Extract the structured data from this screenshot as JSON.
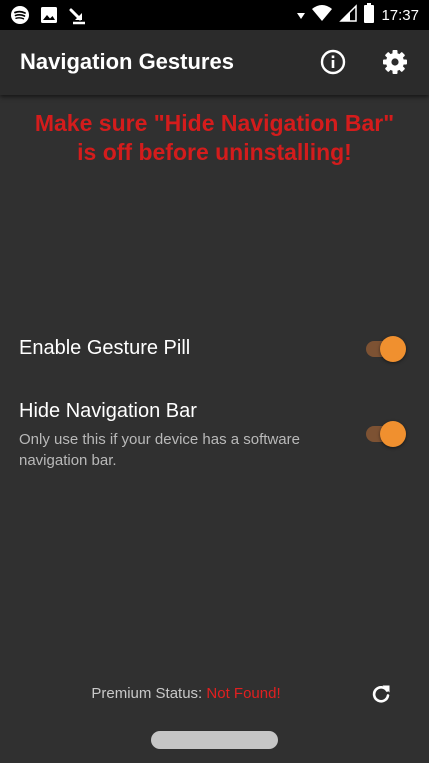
{
  "status_bar": {
    "time": "17:37",
    "left_icons": [
      "spotify-icon",
      "image-icon",
      "download-icon"
    ],
    "right_icons": [
      "signal-arrow-icon",
      "wifi-icon",
      "cell-signal-icon",
      "battery-icon"
    ]
  },
  "app_bar": {
    "title": "Navigation Gestures",
    "actions": [
      "info-icon",
      "settings-icon"
    ]
  },
  "warning": {
    "line1": "Make sure \"Hide Navigation Bar\"",
    "line2": "is off before uninstalling!"
  },
  "settings": [
    {
      "title": "Enable Gesture Pill",
      "summary": "",
      "enabled": true
    },
    {
      "title": "Hide Navigation Bar",
      "summary": "Only use this if your device has a software navigation bar.",
      "enabled": true
    }
  ],
  "premium": {
    "label": "Premium Status:",
    "value": "Not Found!"
  },
  "colors": {
    "background": "#303030",
    "app_bar": "#2b2b2b",
    "warning": "#d41c1c",
    "accent": "#f0902f",
    "status_error": "#e02020"
  }
}
